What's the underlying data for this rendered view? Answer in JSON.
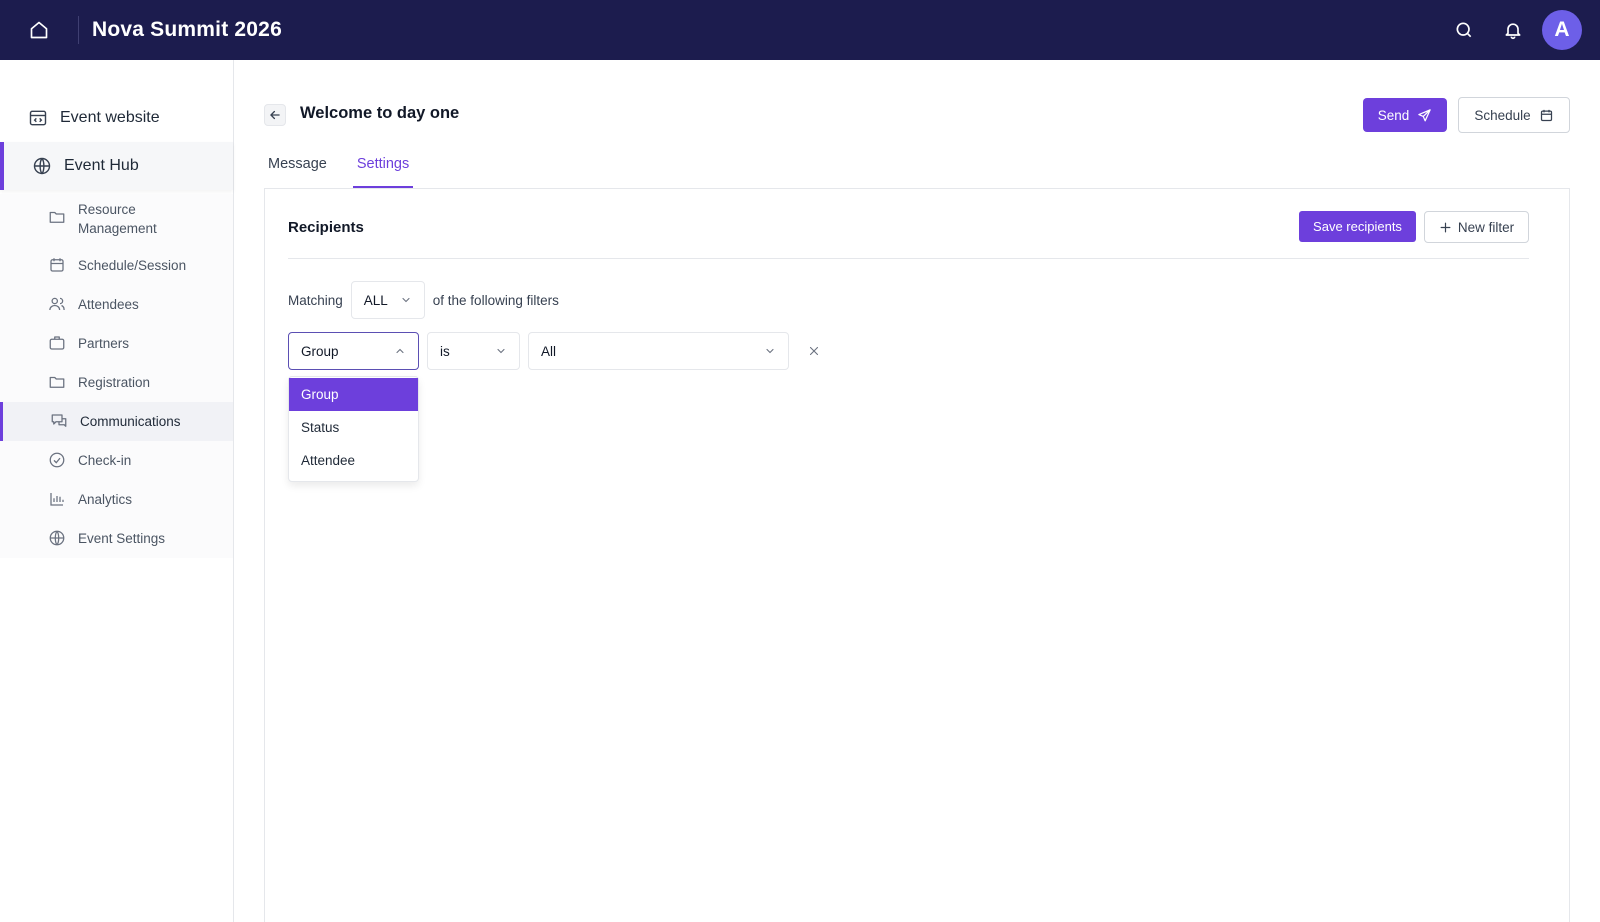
{
  "app": {
    "title": "Nova Summit 2026",
    "avatar_initial": "A"
  },
  "sidebar": {
    "event_website": "Event website",
    "event_hub": "Event Hub",
    "items": [
      {
        "label": "Resource\nManagement",
        "icon": "folder-icon"
      },
      {
        "label": "Schedule/Session",
        "icon": "calendar-icon"
      },
      {
        "label": "Attendees",
        "icon": "users-icon"
      },
      {
        "label": "Partners",
        "icon": "briefcase-icon"
      },
      {
        "label": "Registration",
        "icon": "folder-icon"
      },
      {
        "label": "Communications",
        "icon": "chat-icon",
        "active": true
      },
      {
        "label": "Check-in",
        "icon": "check-circle-icon"
      },
      {
        "label": "Analytics",
        "icon": "bar-chart-icon"
      },
      {
        "label": "Event Settings",
        "icon": "globe-icon"
      }
    ]
  },
  "header": {
    "title": "Welcome to day one",
    "send_label": "Send",
    "schedule_label": "Schedule"
  },
  "tabs": [
    {
      "label": "Message",
      "active": false
    },
    {
      "label": "Settings",
      "active": true
    }
  ],
  "recipients": {
    "title": "Recipients",
    "save_label": "Save recipients",
    "new_filter_label": "New filter",
    "matching_prefix": "Matching",
    "matching_value": "ALL",
    "matching_suffix": "of the following filters",
    "filter": {
      "field": "Group",
      "operator": "is",
      "value": "All"
    },
    "dropdown_options": [
      "Group",
      "Status",
      "Attendee"
    ],
    "dropdown_selected": "Group"
  },
  "colors": {
    "topbar": "#1c1c4e",
    "accent": "#6d3fdc",
    "avatar": "#6d5fe8"
  }
}
